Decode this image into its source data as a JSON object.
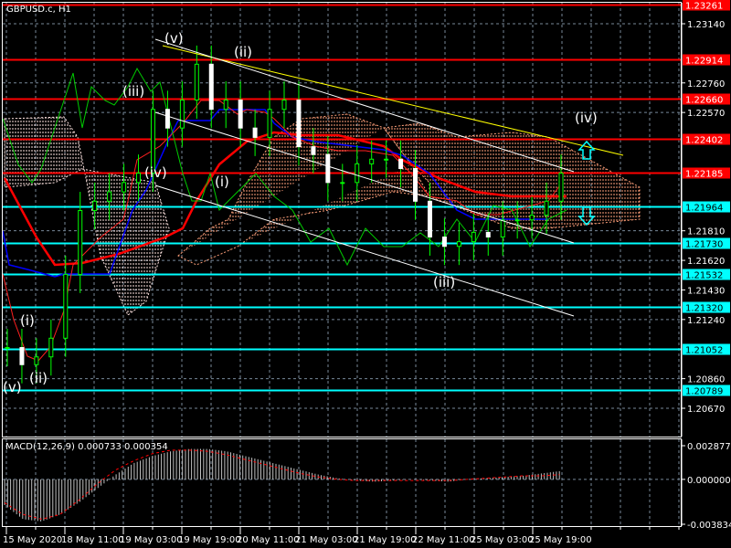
{
  "header": {
    "symbol_timeframe": "GBPUSD.c, H1"
  },
  "colors": {
    "background": "#000000",
    "bull": "#00ff00",
    "resistance": "#ff0000",
    "support": "#00ffff",
    "grid": "#778899",
    "trend_white": "#ffffff",
    "trend_yellow": "#ffff00",
    "kijun": "#ff0000",
    "tenkan": "#0000ff",
    "chikou": "#00cc00",
    "cloud_up": "#ffa07a",
    "cloud_down": "#ffe4e1"
  },
  "chart_data": {
    "type": "line",
    "title": "GBPUSD.c, H1",
    "price_axis_ticks": [
      "1.23140",
      "1.22760",
      "1.22570",
      "1.21810",
      "1.21620",
      "1.21430",
      "1.21240",
      "1.20860",
      "1.20670"
    ],
    "price_range": [
      1.204,
      1.2328
    ],
    "time_ticks": [
      "15 May 2020",
      "18 May 11:00",
      "19 May 03:00",
      "19 May 19:00",
      "20 May 11:00",
      "21 May 03:00",
      "21 May 19:00",
      "22 May 11:00",
      "25 May 03:00",
      "25 May 19:00"
    ],
    "resistance_levels": [
      {
        "label": "1.23261",
        "price": 1.23261
      },
      {
        "label": "1.22914",
        "price": 1.22914
      },
      {
        "label": "1.22660",
        "price": 1.2266
      },
      {
        "label": "1.22402",
        "price": 1.22402
      },
      {
        "label": "1.22185",
        "price": 1.22185
      }
    ],
    "support_levels": [
      {
        "label": "1.21964",
        "price": 1.21964
      },
      {
        "label": "1.21730",
        "price": 1.2173
      },
      {
        "label": "1.21532",
        "price": 1.21532
      },
      {
        "label": "1.21320",
        "price": 1.2132
      },
      {
        "label": "1.21052",
        "price": 1.21052
      },
      {
        "label": "1.20789",
        "price": 1.20789
      }
    ],
    "price_series": [
      1.2106,
      1.2095,
      1.21,
      1.2112,
      1.2153,
      1.2194,
      1.22,
      1.2206,
      1.2212,
      1.2218,
      1.2259,
      1.2247,
      1.2265,
      1.2288,
      1.2259,
      1.2265,
      1.2247,
      1.2241,
      1.2259,
      1.2265,
      1.2235,
      1.223,
      1.2212,
      1.2212,
      1.2224,
      1.2227,
      1.2227,
      1.2221,
      1.22,
      1.2177,
      1.2171,
      1.2174,
      1.218,
      1.2177,
      1.2188,
      1.2188,
      1.2191,
      1.22,
      1.2218
    ],
    "wave_labels": [
      "(v)",
      "(ii)",
      "(iii)",
      "(iv)",
      "(i)",
      "(iii)",
      "(iv)",
      "(i)",
      "(ii)",
      "(v)"
    ],
    "macd": {
      "label": "MACD(12,26,9) 0.000733 0.000354",
      "axis_ticks": [
        "0.002877",
        "0.000000",
        "-0.003834"
      ],
      "range": [
        -0.003834,
        0.002877
      ],
      "histogram_knots": [
        -0.0022,
        -0.0034,
        -0.0036,
        -0.003,
        -0.002,
        -0.0008,
        0.0004,
        0.0014,
        0.002,
        0.0024,
        0.0026,
        0.0026,
        0.0024,
        0.002,
        0.0016,
        0.0012,
        0.0008,
        0.0004,
        0.0001,
        -0.0001,
        -0.0002,
        -0.0001,
        0.0,
        -0.0001,
        -0.0002,
        0.0,
        0.0001,
        0.0002,
        0.0003,
        0.0005,
        0.0007
      ],
      "signal_knots": [
        -0.002,
        -0.003,
        -0.0034,
        -0.003,
        -0.0018,
        -0.0004,
        0.0008,
        0.0016,
        0.0022,
        0.0025,
        0.0025,
        0.0024,
        0.0021,
        0.0017,
        0.0013,
        0.0009,
        0.0005,
        0.0002,
        0.0,
        -0.0001,
        -0.0001,
        -0.0001,
        -0.0001,
        -0.0001,
        -0.0001,
        0.0,
        0.0001,
        0.0002,
        0.0003,
        0.0003,
        0.0004
      ]
    }
  }
}
